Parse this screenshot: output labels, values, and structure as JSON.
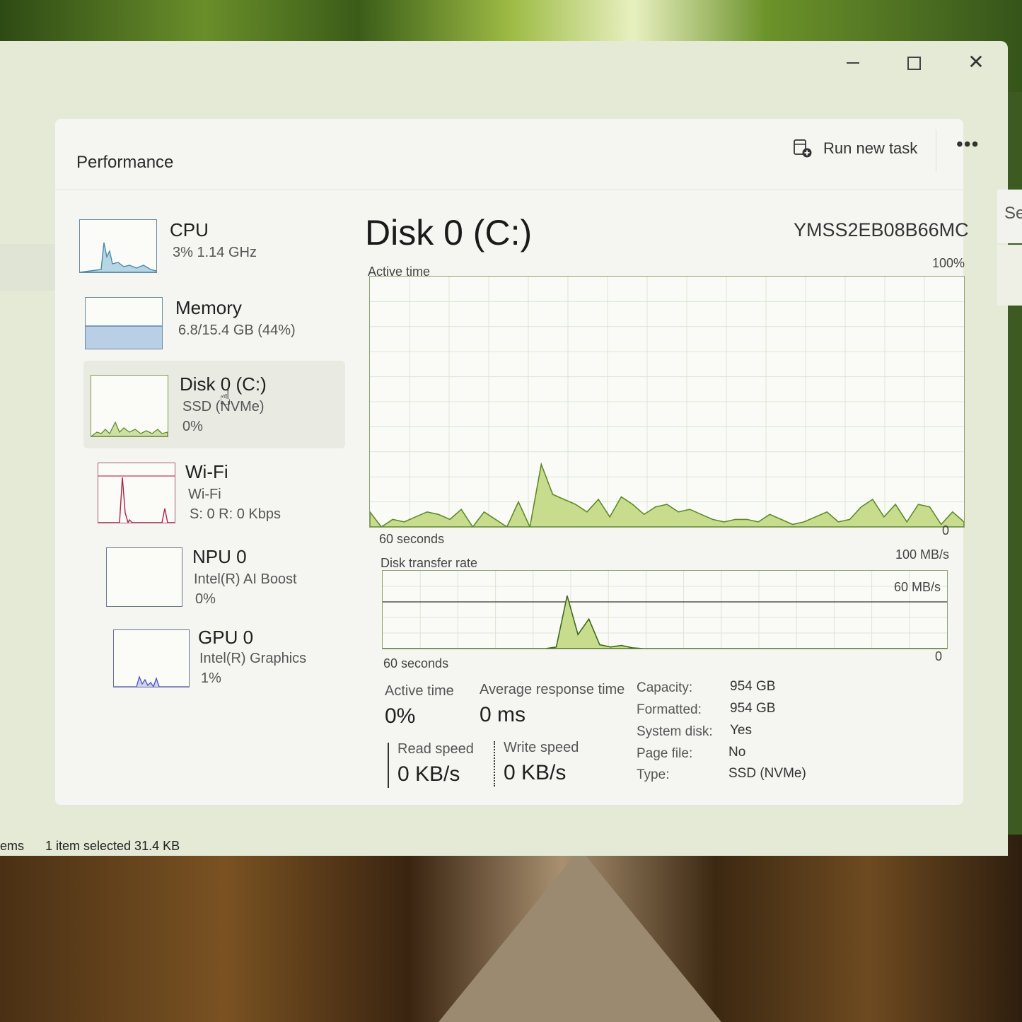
{
  "window": {
    "minimize": "–",
    "close": "✕",
    "status_items": "ems",
    "status_selected": "1 item selected  31.4 KB",
    "side_hint": "Se"
  },
  "header": {
    "title": "Performance",
    "run_task_label": "Run new task",
    "more_label": "•••"
  },
  "sidebar": {
    "items": [
      {
        "id": "cpu",
        "title": "CPU",
        "sub1": "3%  1.14 GHz",
        "sub2": ""
      },
      {
        "id": "memory",
        "title": "Memory",
        "sub1": "6.8/15.4 GB (44%)",
        "sub2": ""
      },
      {
        "id": "disk",
        "title": "Disk 0 (C:)",
        "sub1": "SSD (NVMe)",
        "sub2": "0%"
      },
      {
        "id": "wifi",
        "title": "Wi-Fi",
        "sub1": "Wi-Fi",
        "sub2": "S: 0  R: 0 Kbps"
      },
      {
        "id": "npu",
        "title": "NPU 0",
        "sub1": "Intel(R) AI Boost",
        "sub2": "0%"
      },
      {
        "id": "gpu",
        "title": "GPU 0",
        "sub1": "Intel(R) Graphics",
        "sub2": "1%"
      }
    ]
  },
  "main": {
    "title": "Disk 0 (C:)",
    "model": "YMSS2EB08B66MC",
    "active_chart": {
      "label": "Active time",
      "max_label": "100%",
      "time_label": "60 seconds",
      "min_label": "0"
    },
    "transfer_chart": {
      "label": "Disk transfer rate",
      "max_label": "100 MB/s",
      "mid_label": "60 MB/s",
      "time_label": "60 seconds",
      "min_label": "0"
    },
    "stats": {
      "active_time_label": "Active time",
      "active_time_value": "0%",
      "avg_response_label": "Average response time",
      "avg_response_value": "0 ms",
      "read_label": "Read speed",
      "read_value": "0 KB/s",
      "write_label": "Write speed",
      "write_value": "0 KB/s"
    },
    "properties": [
      {
        "key": "Capacity:",
        "value": "954 GB"
      },
      {
        "key": "Formatted:",
        "value": "954 GB"
      },
      {
        "key": "System disk:",
        "value": "Yes"
      },
      {
        "key": "Page file:",
        "value": "No"
      },
      {
        "key": "Type:",
        "value": "SSD (NVMe)"
      }
    ]
  },
  "chart_data": [
    {
      "type": "area",
      "title": "Active time",
      "xlabel": "60 seconds",
      "ylim": [
        0,
        100
      ],
      "series": [
        {
          "values": [
            6,
            0,
            3,
            2,
            4,
            6,
            5,
            3,
            7,
            0,
            6,
            3,
            0,
            10,
            0,
            25,
            13,
            11,
            9,
            6,
            11,
            4,
            12,
            9,
            5,
            8,
            9,
            6,
            7,
            5,
            3,
            2,
            3,
            3,
            2,
            5,
            3,
            1,
            2,
            4,
            6,
            2,
            3,
            8,
            11,
            4,
            9,
            2,
            9,
            8,
            1,
            6,
            2
          ]
        }
      ]
    },
    {
      "type": "area",
      "title": "Disk transfer rate",
      "xlabel": "60 seconds",
      "ylim": [
        0,
        100
      ],
      "series": [
        {
          "values": [
            0,
            0,
            0,
            0,
            0,
            0,
            0,
            0,
            0,
            0,
            0,
            0,
            0,
            0,
            0,
            0,
            2,
            68,
            18,
            38,
            5,
            2,
            4,
            1,
            0,
            0,
            0,
            0,
            0,
            0,
            0,
            0,
            0,
            0,
            0,
            0,
            0,
            0,
            0,
            0,
            0,
            0,
            0,
            0,
            0,
            0,
            0,
            0,
            0,
            0,
            0,
            0,
            0
          ]
        }
      ]
    }
  ]
}
